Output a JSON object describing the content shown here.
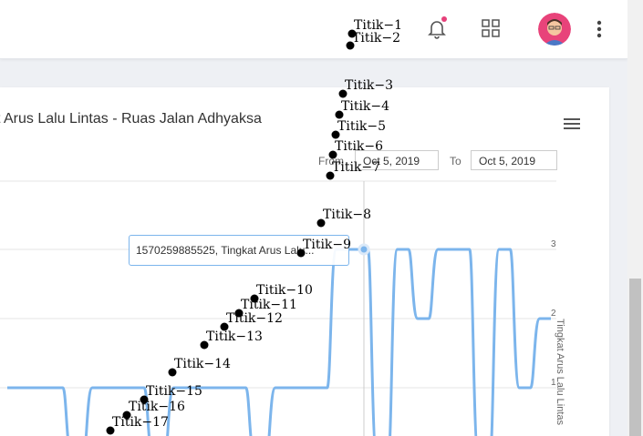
{
  "header": {
    "bell_icon": "bell-icon",
    "apps_icon": "grid-icon",
    "avatar_icon": "avatar",
    "more_icon": "kebab-icon",
    "close_glyph": "×"
  },
  "card": {
    "title": "t Arus Lalu Lintas - Ruas Jalan Adhyaksa",
    "range": {
      "from_label": "From",
      "from_value": "Oct 5, 2019",
      "to_label": "To",
      "to_value": "Oct 5, 2019"
    },
    "menu_icon": "hamburger-menu-icon"
  },
  "chart_data": {
    "type": "line",
    "title": "t Arus Lalu Lintas - Ruas Jalan Adhyaksa",
    "ylabel": "Tingkat Arus Lalu Lintas",
    "ylim": [
      0,
      3
    ],
    "y_ticks": [
      "1",
      "2",
      "3"
    ],
    "series": [
      {
        "color": "#7cb5ec",
        "values": [
          1,
          1,
          1,
          0,
          1,
          1,
          1,
          0,
          1,
          1,
          1,
          1,
          0,
          1,
          1,
          1,
          3,
          3,
          0,
          3,
          2,
          3,
          3,
          0,
          3,
          1,
          2
        ]
      }
    ],
    "tooltip": "1570259885525, Tingkat Arus Lalu..."
  },
  "annotations": [
    {
      "label": "Titik-1"
    },
    {
      "label": "Titik-2"
    },
    {
      "label": "Titik-3"
    },
    {
      "label": "Titik-4"
    },
    {
      "label": "Titik-5"
    },
    {
      "label": "Titik-6"
    },
    {
      "label": "Titik-7"
    },
    {
      "label": "Titik-8"
    },
    {
      "label": "Titik-9"
    },
    {
      "label": "Titik-10"
    },
    {
      "label": "Titik-11"
    },
    {
      "label": "Titik-12"
    },
    {
      "label": "Titik-13"
    },
    {
      "label": "Titik-14"
    },
    {
      "label": "Titik-15"
    },
    {
      "label": "Titik-16"
    },
    {
      "label": "Titik-17"
    }
  ]
}
